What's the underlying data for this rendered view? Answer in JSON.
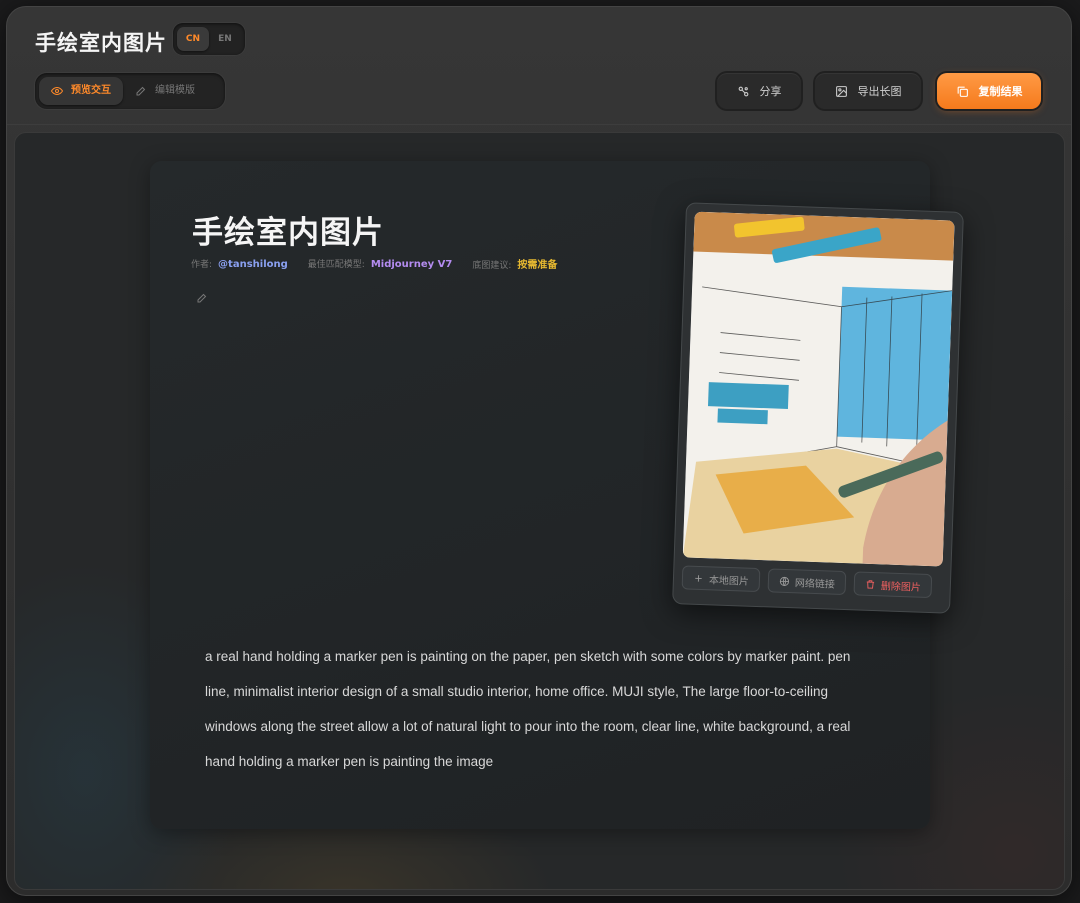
{
  "app": {
    "title": "手绘室内图片",
    "lang": {
      "cn": "CN",
      "en": "EN",
      "active": "CN"
    }
  },
  "mode": {
    "preview_label": "预览交互",
    "edit_label": "编辑模版",
    "active": "preview"
  },
  "toolbar": {
    "share_label": "分享",
    "export_label": "导出长图",
    "copy_label": "复制结果"
  },
  "card": {
    "title": "手绘室内图片",
    "meta": {
      "author_label": "作者:",
      "author": "@tanshilong",
      "model_label": "最佳匹配模型:",
      "model": "Midjourney V7",
      "suggest_label": "底图建议:",
      "suggest": "按需准备"
    },
    "prompt": "a real hand holding a marker pen is painting on the paper, pen sketch with some colors by marker paint. pen line, minimalist interior design of a small studio interior, home office. MUJI style, The large floor-to-ceiling windows along the street allow a lot of natural light to pour into the room, clear line, white background, a real hand holding a marker pen is painting the image"
  },
  "image_actions": {
    "local_label": "本地图片",
    "link_label": "网络链接",
    "delete_label": "删除图片"
  },
  "colors": {
    "accent": "#ff8a2a",
    "author": "#8aa0f0",
    "model": "#b48cf0",
    "suggest": "#e6b830",
    "danger": "#f06060"
  }
}
